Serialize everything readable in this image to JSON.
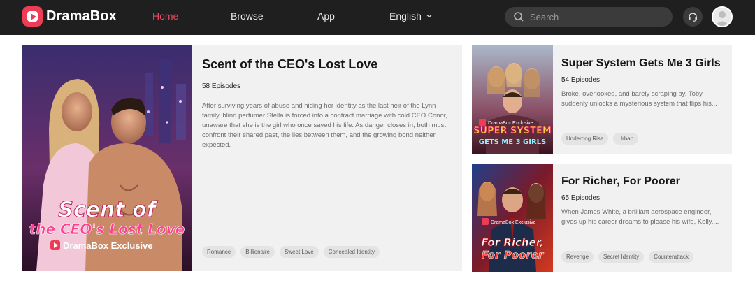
{
  "header": {
    "brand": "DramaBox",
    "nav": {
      "home": "Home",
      "browse": "Browse",
      "app": "App",
      "language": "English"
    },
    "search_placeholder": "Search",
    "accent_color": "#ee3c57"
  },
  "featured": {
    "title": "Scent of the CEO's Lost Love",
    "episodes": "58 Episodes",
    "description": "After surviving years of abuse and hiding her identity as the last heir of the Lynn family, blind perfumer Stella is forced into a contract marriage with cold CEO Conor, unaware that she is the girl who once saved his life. As danger closes in, both must confront their shared past, the lies between them, and the growing bond neither expected.",
    "tags": [
      "Romance",
      "Billionaire",
      "Sweet Love",
      "Concealed Identity"
    ],
    "poster": {
      "line1": "Scent of",
      "line2": "the CEO's Lost Love",
      "badge": "DramaBox Exclusive"
    }
  },
  "side_cards": [
    {
      "title": "Super System Gets Me 3 Girls",
      "episodes": "54 Episodes",
      "description": "Broke, overlooked, and barely scraping by, Toby suddenly unlocks a mysterious system that flips his...",
      "tags": [
        "Underdog Rise",
        "Urban"
      ],
      "poster": {
        "badge": "DramaBox Exclusive",
        "line1": "SUPER SYSTEM",
        "line2": "GETS ME 3 GIRLS"
      }
    },
    {
      "title": "For Richer, For Poorer",
      "episodes": "65 Episodes",
      "description": "When James White, a brilliant aerospace engineer, gives up his career dreams to please his wife, Kelly,...",
      "tags": [
        "Revenge",
        "Secret Identity",
        "Counterattack"
      ],
      "poster": {
        "badge": "DramaBox Exclusive",
        "line1": "For Richer,",
        "line2": "For Poorer"
      }
    }
  ]
}
